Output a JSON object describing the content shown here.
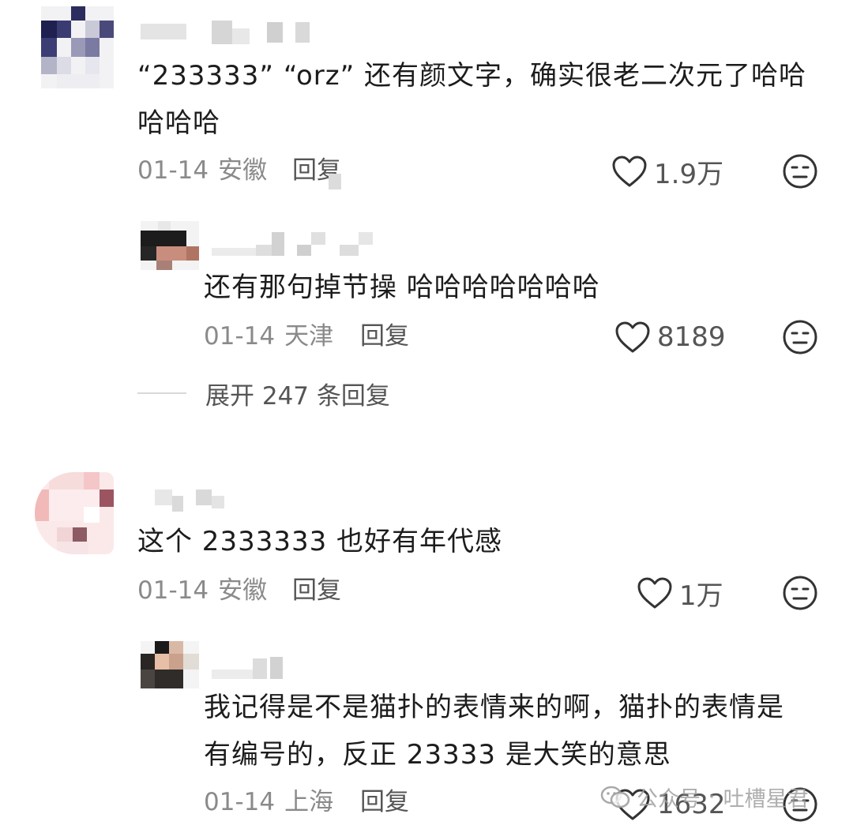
{
  "comments": [
    {
      "text": "“233333” “orz” 还有颜文字，确实很老二次元了哈哈哈哈哈",
      "date": "01-14",
      "location": "安徽",
      "reply_label": "回复",
      "likes": "1.9万",
      "replies": [
        {
          "text": "还有那句掉节操 哈哈哈哈哈哈哈",
          "date": "01-14",
          "location": "天津",
          "reply_label": "回复",
          "likes": "8189"
        }
      ],
      "expand_label": "展开 247 条回复"
    },
    {
      "text": "这个 2333333 也好有年代感",
      "date": "01-14",
      "location": "安徽",
      "reply_label": "回复",
      "likes": "1万",
      "replies": [
        {
          "text": "我记得是不是猫扑的表情来的啊，猫扑的表情是有编号的，反正 23333 是大笑的意思",
          "date": "01-14",
          "location": "上海",
          "reply_label": "回复",
          "likes": "1632"
        }
      ]
    }
  ],
  "watermark": {
    "icon": "wechat-icon",
    "source": "公众号",
    "name": "吐槽星君"
  },
  "icons": {
    "like": "heart-outline-icon",
    "reaction": "neutral-face-icon"
  }
}
